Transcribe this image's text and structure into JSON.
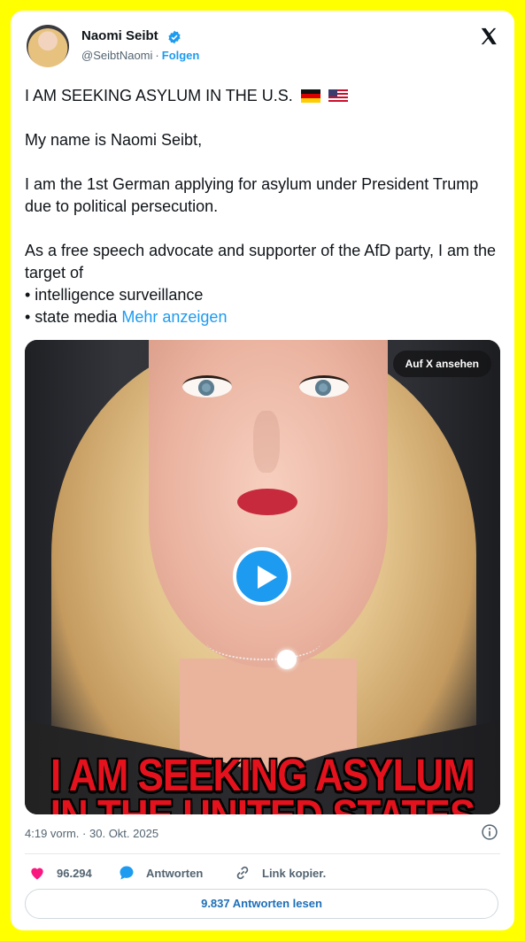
{
  "author": {
    "name": "Naomi Seibt",
    "handle": "@SeibtNaomi",
    "separator": "·",
    "follow_label": "Folgen"
  },
  "tweet": {
    "line1": "I AM SEEKING ASYLUM IN THE U.S.",
    "line1_flags": [
      "flag-germany-icon",
      "flag-usa-icon"
    ],
    "line2": "My name is Naomi Seibt,",
    "line3": "I am the 1st German applying for asylum under President Trump due to political persecution.",
    "line4": "As a free speech advocate and supporter of the AfD party, I am the target of",
    "bullet1": "• intelligence surveillance",
    "bullet2": "• state media",
    "show_more": "Mehr anzeigen"
  },
  "media": {
    "view_on_x": "Auf X ansehen",
    "caption_line1": "I AM SEEKING ASYLUM",
    "caption_line2": "IN THE UNITED STATES"
  },
  "meta": {
    "time": "4:19 vorm.",
    "separator": "·",
    "date": "30. Okt. 2025"
  },
  "actions": {
    "likes": "96.294",
    "reply_label": "Antworten",
    "copy_link_label": "Link kopier."
  },
  "read_replies": "9.837 Antworten lesen",
  "colors": {
    "accent": "#1d9bf0",
    "like": "#f91880",
    "frame": "#ffff00",
    "caption": "#e4121d"
  }
}
